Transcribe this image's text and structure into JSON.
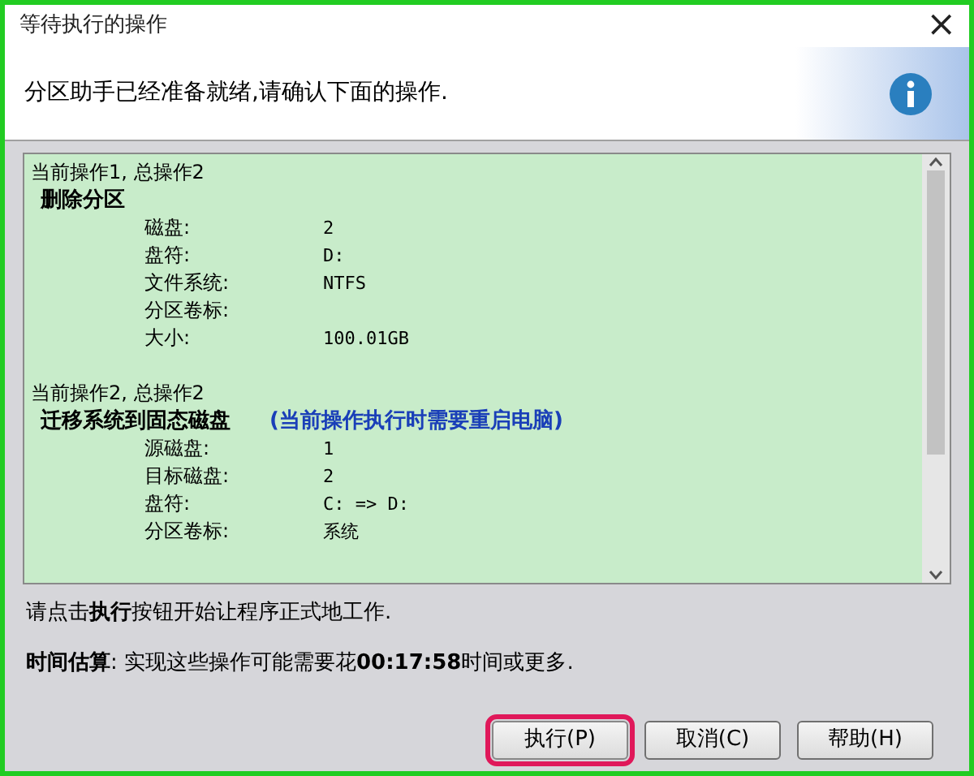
{
  "window": {
    "title": "等待执行的操作",
    "close": "×"
  },
  "header": {
    "message": "分区助手已经准备就绪,请确认下面的操作."
  },
  "operations": [
    {
      "heading": "当前操作1, 总操作2",
      "title": "删除分区",
      "fields": [
        {
          "label": "磁盘:",
          "value": "2"
        },
        {
          "label": "盘符:",
          "value": "D:"
        },
        {
          "label": "文件系统:",
          "value": "NTFS"
        },
        {
          "label": "分区卷标:"
        },
        {
          "label": "大小:",
          "value": "100.01GB"
        }
      ]
    },
    {
      "heading": "当前操作2, 总操作2",
      "title": "迁移系统到固态磁盘",
      "note": "(当前操作执行时需要重启电脑)",
      "fields": [
        {
          "label": "源磁盘:",
          "value": "1"
        },
        {
          "label": "目标磁盘:",
          "value": "2"
        },
        {
          "label": "盘符:",
          "value": "C: => D:"
        },
        {
          "label": "分区卷标:",
          "value": "系统"
        }
      ]
    }
  ],
  "instruction": "请点击**执行**按钮开始让程序正式地工作.",
  "estimate": "**时间估算**: 实现这些操作可能需要花**00:17:58**时间或更多.",
  "buttons": [
    {
      "label": "执行(P)",
      "highlighted": true
    },
    {
      "label": "取消(C)",
      "highlighted": false
    },
    {
      "label": "帮助(H)",
      "highlighted": false
    }
  ]
}
